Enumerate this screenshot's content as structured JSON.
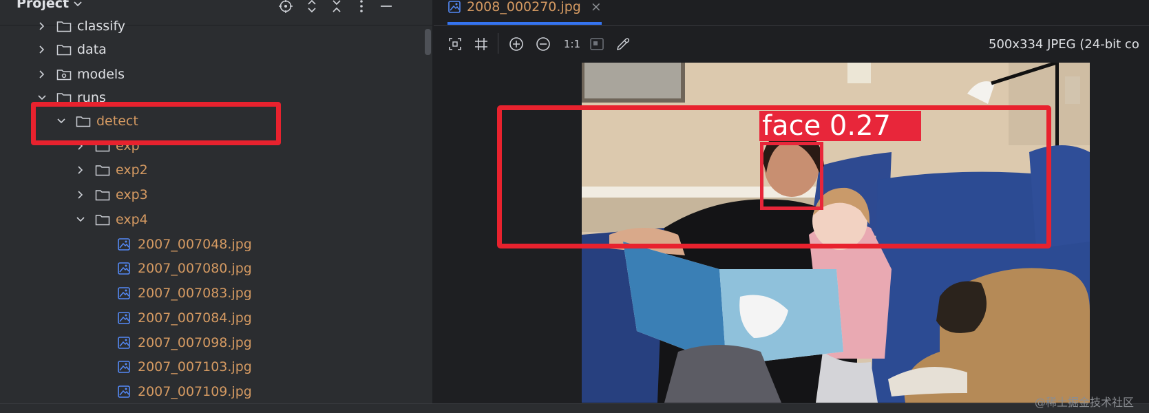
{
  "project_panel": {
    "title": "Project",
    "header_icons": [
      "locate-icon",
      "expand-all-icon",
      "collapse-all-icon",
      "more-options-icon",
      "minimize-icon"
    ]
  },
  "tree": {
    "items": [
      {
        "label": "classify",
        "type": "folder",
        "expanded": false,
        "level": 2
      },
      {
        "label": "data",
        "type": "folder",
        "expanded": false,
        "level": 2
      },
      {
        "label": "models",
        "type": "package",
        "expanded": false,
        "level": 2
      },
      {
        "label": "runs",
        "type": "folder",
        "expanded": true,
        "level": 2
      },
      {
        "label": "detect",
        "type": "folder",
        "expanded": true,
        "level": 3
      },
      {
        "label": "exp",
        "type": "folder",
        "expanded": false,
        "level": 4
      },
      {
        "label": "exp2",
        "type": "folder",
        "expanded": false,
        "level": 4
      },
      {
        "label": "exp3",
        "type": "folder",
        "expanded": false,
        "level": 4
      },
      {
        "label": "exp4",
        "type": "folder",
        "expanded": true,
        "level": 4
      },
      {
        "label": "2007_007048.jpg",
        "type": "image",
        "level": 5
      },
      {
        "label": "2007_007080.jpg",
        "type": "image",
        "level": 5
      },
      {
        "label": "2007_007083.jpg",
        "type": "image",
        "level": 5
      },
      {
        "label": "2007_007084.jpg",
        "type": "image",
        "level": 5
      },
      {
        "label": "2007_007098.jpg",
        "type": "image",
        "level": 5
      },
      {
        "label": "2007_007103.jpg",
        "type": "image",
        "level": 5
      },
      {
        "label": "2007_007109.jpg",
        "type": "image",
        "level": 5
      }
    ]
  },
  "editor": {
    "tab": {
      "label": "2008_000270.jpg",
      "close": "×"
    },
    "toolbar": {
      "actual_size_label": "1:1",
      "buttons": [
        "fit-zoom-icon",
        "grid-icon",
        "zoom-in-icon",
        "zoom-out-icon",
        "actual-size",
        "background-icon",
        "color-picker-icon"
      ]
    },
    "image_info": "500x334 JPEG (24-bit co"
  },
  "detection": {
    "label": "face 0.27",
    "class": "face",
    "confidence": 0.27
  },
  "watermark": "@稀土掘金技术社区",
  "colors": {
    "panel_bg": "#2b2d30",
    "editor_bg": "#1e1f22",
    "accent_blue": "#3574f0",
    "folder_text": "#d59a62",
    "detection_red": "#e8263a",
    "highlight_red": "#e8222e"
  }
}
